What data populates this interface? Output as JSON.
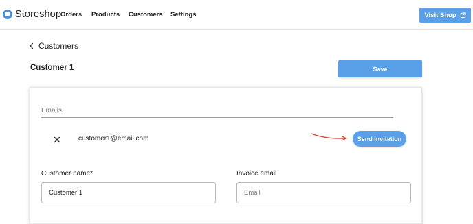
{
  "app": {
    "name": "Storeshop",
    "brand_color": "#4f8fd6",
    "accent_color": "#5aa0e9"
  },
  "nav": {
    "items": [
      {
        "label": "Orders"
      },
      {
        "label": "Products"
      },
      {
        "label": "Customers"
      },
      {
        "label": "Settings"
      }
    ],
    "visit_shop_label": "Visit Shop",
    "visit_shop_icon": "external-link-icon"
  },
  "breadcrumb": {
    "back_icon": "chevron-left-icon",
    "label": "Customers"
  },
  "page": {
    "title": "Customer 1",
    "save_label": "Save"
  },
  "emails": {
    "label": "Emails",
    "items": [
      {
        "email": "customer1@email.com",
        "remove_icon": "close-icon",
        "action_label": "Send Invitation"
      }
    ],
    "annotation_color": "#e0452b"
  },
  "form": {
    "customer_name": {
      "label": "Customer name*",
      "value": "Customer 1"
    },
    "invoice_email": {
      "label": "Invoice email",
      "placeholder": "Email",
      "value": ""
    }
  }
}
